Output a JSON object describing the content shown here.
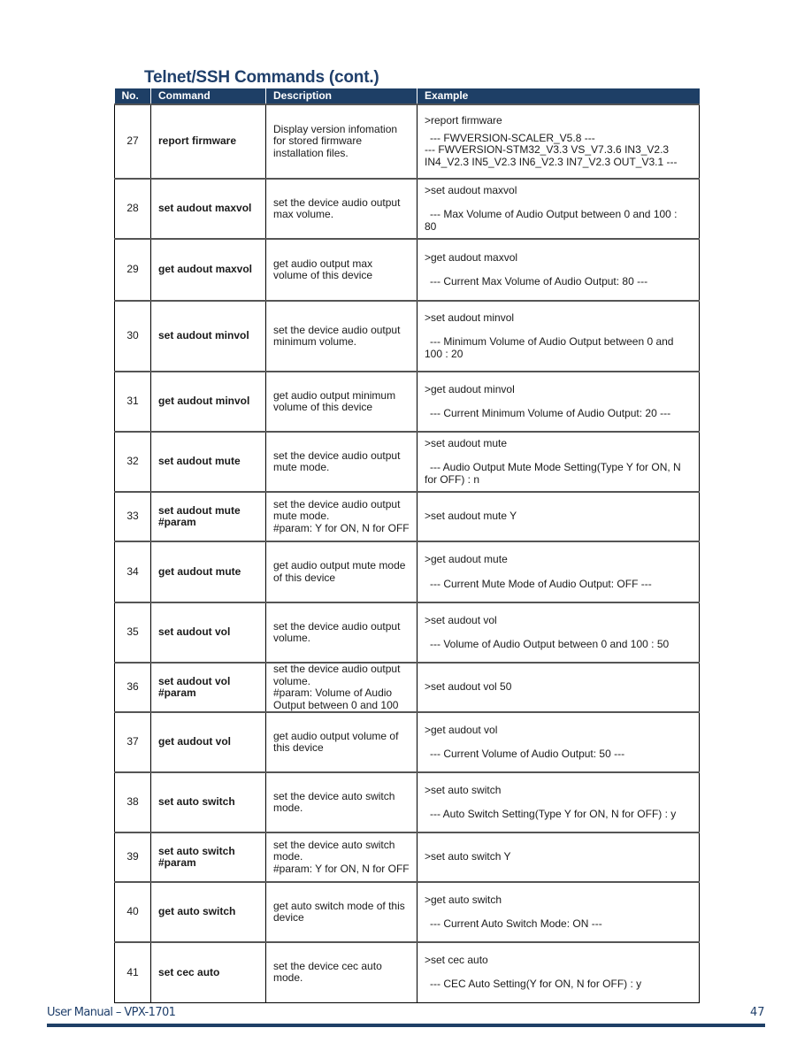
{
  "page": {
    "title": "Telnet/SSH Commands (cont.)",
    "footer": {
      "manual": "User Manual – VPX-1701",
      "page_number": "47"
    },
    "accent_color": "#1e3f66"
  },
  "table": {
    "headers": [
      "No.",
      "Command",
      "Description",
      "Example"
    ],
    "rows": [
      {
        "no": "27",
        "command": "report firmware",
        "description": "Display version infomation for stored firmware installation files.",
        "example_cmd": ">report firmware",
        "example_resp": "--- FWVERSION-SCALER_V5.8 ---\n--- FWVERSION-STM32_V3.3 VS_V7.3.6 IN3_V2.3 IN4_V2.3 IN5_V2.3 IN6_V2.3 IN7_V2.3 OUT_V3.1 ---"
      },
      {
        "no": "28",
        "command": "set audout maxvol",
        "description": "set the device audio output max volume.",
        "example_cmd": ">set audout maxvol",
        "example_resp": "--- Max Volume of Audio Output between 0 and 100 : 80"
      },
      {
        "no": "29",
        "command": "get audout maxvol",
        "description": "get audio output max volume of this device",
        "example_cmd": ">get audout maxvol",
        "example_resp": "--- Current Max Volume of Audio Output: 80 ---"
      },
      {
        "no": "30",
        "command": "set audout minvol",
        "description": "set the device audio output minimum volume.",
        "example_cmd": ">set audout minvol",
        "example_resp": "--- Minimum Volume of Audio Output between 0 and 100 : 20"
      },
      {
        "no": "31",
        "command": "get audout minvol",
        "description": "get audio output minimum volume of this device",
        "example_cmd": ">get audout minvol",
        "example_resp": "--- Current Minimum Volume of Audio Output: 20 ---"
      },
      {
        "no": "32",
        "command": "set audout mute",
        "description": "set the device audio output mute mode.",
        "example_cmd": ">set audout mute",
        "example_resp": "--- Audio Output Mute Mode Setting(Type Y for ON, N for OFF) : n"
      },
      {
        "no": "33",
        "command": "set audout mute #param",
        "description": "set the device audio output mute mode.\n#param: Y for ON, N for OFF",
        "example_cmd": ">set audout mute Y",
        "example_resp": ""
      },
      {
        "no": "34",
        "command": "get audout mute",
        "description": "get audio output mute mode of this device",
        "example_cmd": ">get audout mute",
        "example_resp": "--- Current Mute Mode of Audio Output: OFF ---"
      },
      {
        "no": "35",
        "command": "set audout vol",
        "description": "set the device audio output volume.",
        "example_cmd": ">set audout vol",
        "example_resp": "--- Volume of Audio Output between 0 and 100 : 50"
      },
      {
        "no": "36",
        "command": "set audout vol #param",
        "description": "set the device audio output volume.\n#param: Volume of Audio Output between 0 and 100",
        "example_cmd": ">set audout vol 50",
        "example_resp": ""
      },
      {
        "no": "37",
        "command": "get audout vol",
        "description": "get audio output volume of this device",
        "example_cmd": ">get audout vol",
        "example_resp": "--- Current Volume of Audio Output: 50 ---"
      },
      {
        "no": "38",
        "command": "set auto switch",
        "description": "set the device auto switch mode.",
        "example_cmd": ">set auto switch",
        "example_resp": "--- Auto Switch Setting(Type Y for ON, N for OFF) : y"
      },
      {
        "no": "39",
        "command": "set auto switch #param",
        "description": "set the device auto switch mode.\n#param: Y for ON, N for OFF",
        "example_cmd": ">set auto switch Y",
        "example_resp": ""
      },
      {
        "no": "40",
        "command": "get auto switch",
        "description": "get auto switch mode of this device",
        "example_cmd": ">get auto switch",
        "example_resp": "--- Current Auto Switch Mode: ON ---"
      },
      {
        "no": "41",
        "command": "set cec auto",
        "description": "set the device cec auto mode.",
        "example_cmd": ">set cec auto",
        "example_resp": "--- CEC Auto Setting(Y for ON, N for OFF) : y"
      }
    ]
  }
}
